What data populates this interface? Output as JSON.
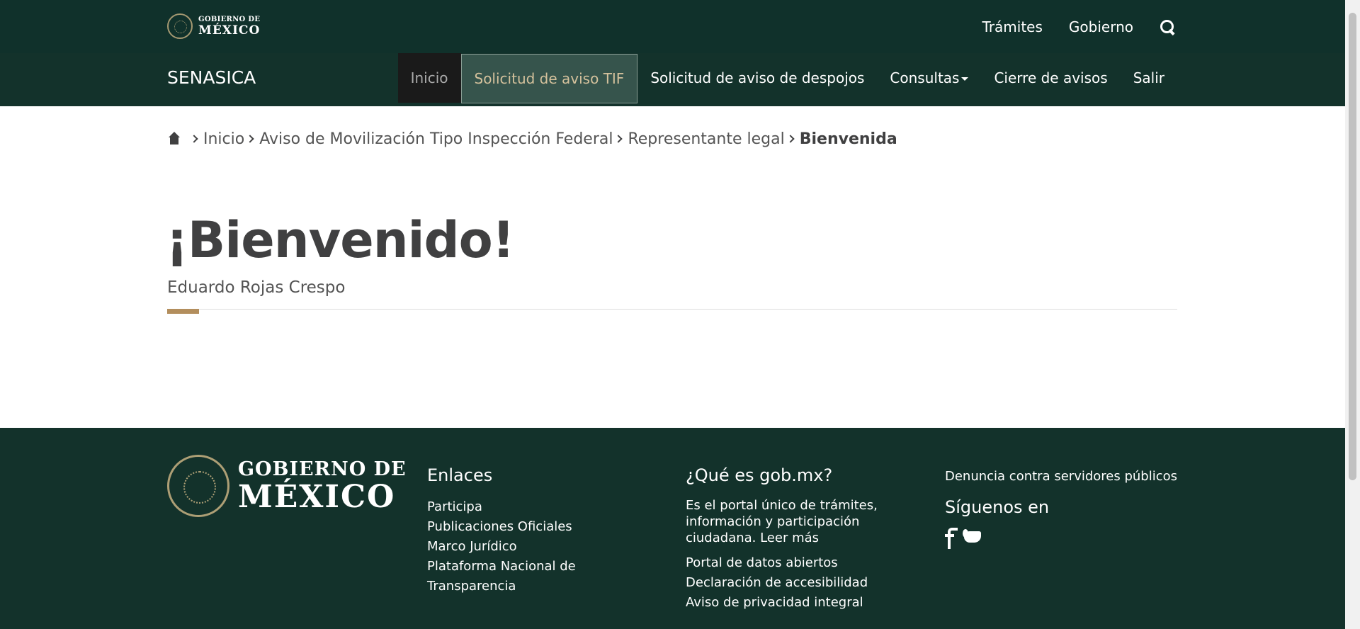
{
  "topbar": {
    "logo_line1": "GOBIERNO DE",
    "logo_line2": "MÉXICO",
    "links": [
      "Trámites",
      "Gobierno"
    ],
    "search_icon": "search-icon"
  },
  "subnav": {
    "brand": "SENASICA",
    "items": [
      {
        "label": "Inicio"
      },
      {
        "label": "Solicitud de aviso TIF"
      },
      {
        "label": "Solicitud de aviso de despojos"
      },
      {
        "label": "Consultas"
      },
      {
        "label": "Cierre de avisos"
      },
      {
        "label": "Salir"
      }
    ]
  },
  "breadcrumb": {
    "home_icon": "home-icon",
    "items": [
      "Inicio",
      "Aviso de Movilización Tipo Inspección Federal",
      "Representante legal",
      "Bienvenida"
    ]
  },
  "main": {
    "title": "¡Bienvenido!",
    "user_name": "Eduardo Rojas Crespo"
  },
  "footer": {
    "logo_line1": "GOBIERNO DE",
    "logo_line2": "MÉXICO",
    "enlaces": {
      "heading": "Enlaces",
      "links": [
        "Participa",
        "Publicaciones Oficiales",
        "Marco Jurídico",
        "Plataforma Nacional de Transparencia"
      ]
    },
    "que_es": {
      "heading": "¿Qué es gob.mx?",
      "description": "Es el portal único de trámites, información y participación ciudadana. Leer más",
      "links": [
        "Portal de datos abiertos",
        "Declaración de accesibilidad",
        "Aviso de privacidad integral"
      ]
    },
    "denuncia": "Denuncia contra servidores públicos",
    "siguenos": "Síguenos en",
    "social_icons": [
      "facebook-icon",
      "twitter-icon"
    ]
  },
  "colors": {
    "topbar_bg": "#10312b",
    "subnav_bg": "#13322b",
    "accent": "#b38e5d",
    "active_text": "#d4c19c"
  }
}
